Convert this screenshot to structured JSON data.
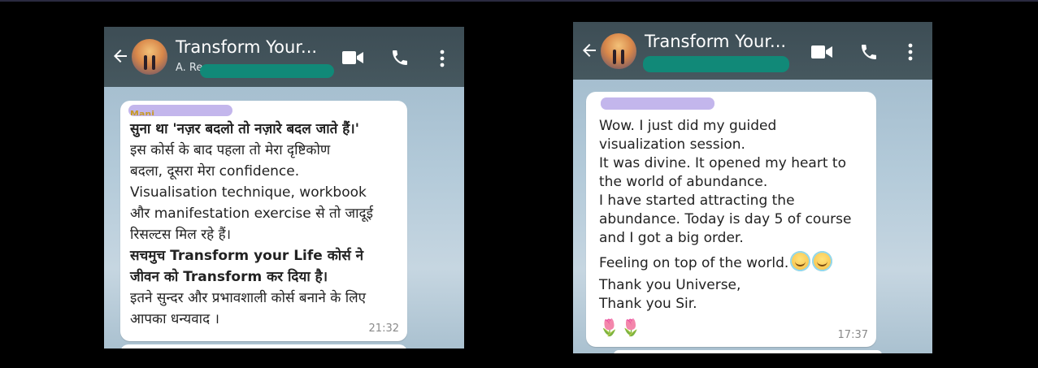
{
  "screenshots": [
    {
      "header": {
        "title": "Transform Your...",
        "subtitle_visible": "A. Re"
      },
      "message": {
        "sender_visible": "Mani",
        "lines": [
          {
            "text": "सुना था 'नज़र बदलो तो नज़ारे बदल जाते हैं।'",
            "bold": true
          },
          {
            "text": "इस कोर्स के बाद पहला तो मेरा दृष्टिकोण",
            "bold": false
          },
          {
            "text": "बदला, दूसरा मेरा confidence.",
            "bold": false
          },
          {
            "text": "Visualisation technique, workbook",
            "bold": false
          },
          {
            "text": "और manifestation exercise से तो जादूई",
            "bold": false
          },
          {
            "text": "रिसल्टस मिल रहे हैं।",
            "bold": false
          },
          {
            "text": "सचमुच Transform your Life कोर्स ने",
            "bold": true
          },
          {
            "text": "जीवन को Transform कर दिया है।",
            "bold": true
          },
          {
            "text": "इतने सुन्दर और प्रभावशाली कोर्स बनाने के लिए",
            "bold": false
          },
          {
            "text": "आपका धन्यवाद ।",
            "bold": false
          }
        ],
        "time": "21:32"
      }
    },
    {
      "header": {
        "title": "Transform Your..."
      },
      "message": {
        "lines": [
          "Wow.  I just did my guided",
          "visualization session.",
          "It was divine.  It opened my heart to",
          "the world of abundance.",
          "I have started attracting the",
          "abundance.  Today is day 5 of course",
          "and I got a big order.",
          "Feeling on top of the world.",
          "Thank you Universe,",
          "Thank you Sir."
        ],
        "emoji_after_line_8": "smiling-face-with-halo",
        "flowers": "🌷🌷",
        "time": "17:37"
      }
    }
  ],
  "colors": {
    "app_bar": "#435459",
    "chat_bg": "#b3cad9",
    "bubble": "#ffffff",
    "redaction_green": "#0f8c79",
    "redaction_purple": "#c3b6ec"
  },
  "icons": [
    "back-arrow-icon",
    "video-call-icon",
    "phone-icon",
    "more-options-icon"
  ]
}
